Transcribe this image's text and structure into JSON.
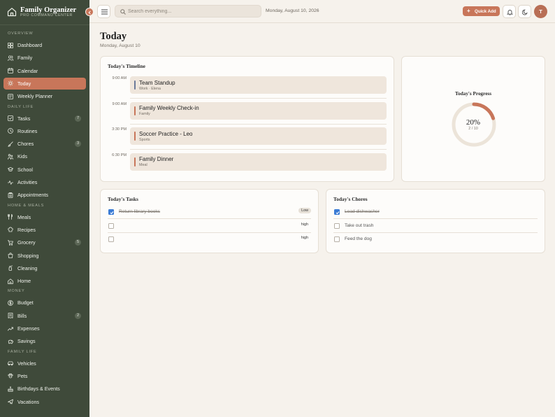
{
  "brand": {
    "title": "Family Organizer",
    "subtitle": "PRO COMMAND CENTER"
  },
  "sidebar": {
    "sections": [
      {
        "label": "OVERVIEW",
        "items": [
          {
            "label": "Dashboard",
            "icon": "grid-icon"
          },
          {
            "label": "Family",
            "icon": "users-icon"
          },
          {
            "label": "Calendar",
            "icon": "calendar-icon"
          },
          {
            "label": "Today",
            "icon": "sun-icon",
            "active": true
          },
          {
            "label": "Weekly Planner",
            "icon": "planner-icon"
          }
        ]
      },
      {
        "label": "DAILY LIFE",
        "items": [
          {
            "label": "Tasks",
            "icon": "check-square-icon",
            "badge": "7"
          },
          {
            "label": "Routines",
            "icon": "clock-icon"
          },
          {
            "label": "Chores",
            "icon": "brush-icon",
            "badge": "3"
          },
          {
            "label": "Kids",
            "icon": "kids-icon"
          },
          {
            "label": "School",
            "icon": "graduation-cap-icon"
          },
          {
            "label": "Activities",
            "icon": "activity-icon"
          },
          {
            "label": "Appointments",
            "icon": "clipboard-icon"
          }
        ]
      },
      {
        "label": "HOME & MEALS",
        "items": [
          {
            "label": "Meals",
            "icon": "utensils-icon"
          },
          {
            "label": "Recipes",
            "icon": "chef-hat-icon"
          },
          {
            "label": "Grocery",
            "icon": "cart-icon",
            "badge": "5"
          },
          {
            "label": "Shopping",
            "icon": "shopping-bag-icon"
          },
          {
            "label": "Cleaning",
            "icon": "spray-bottle-icon"
          },
          {
            "label": "Home",
            "icon": "home-icon"
          }
        ]
      },
      {
        "label": "MONEY",
        "items": [
          {
            "label": "Budget",
            "icon": "dollar-circle-icon"
          },
          {
            "label": "Bills",
            "icon": "receipt-icon",
            "badge": "2"
          },
          {
            "label": "Expenses",
            "icon": "trending-icon"
          },
          {
            "label": "Savings",
            "icon": "piggy-bank-icon"
          }
        ]
      },
      {
        "label": "FAMILY LIFE",
        "items": [
          {
            "label": "Vehicles",
            "icon": "car-icon"
          },
          {
            "label": "Pets",
            "icon": "paw-icon"
          },
          {
            "label": "Birthdays & Events",
            "icon": "cake-icon"
          },
          {
            "label": "Vacations",
            "icon": "plane-icon"
          }
        ]
      }
    ]
  },
  "topbar": {
    "search_placeholder": "Search everything...",
    "date": "Monday, August 10, 2026",
    "quick_add_label": "Quick Add",
    "avatar_initial": "T"
  },
  "page": {
    "title": "Today",
    "subtitle": "Monday, August 10"
  },
  "timeline": {
    "title": "Today's Timeline",
    "events": [
      {
        "time": "9:00 AM",
        "name": "Team Standup",
        "meta": "Work · Elena",
        "color": "#6c7a9a"
      },
      {
        "time": "9:00 AM",
        "name": "Family Weekly Check-in",
        "meta": "Family",
        "color": "#c8765a"
      },
      {
        "time": "3:30 PM",
        "name": "Soccer Practice - Leo",
        "meta": "Sports",
        "color": "#c8765a"
      },
      {
        "time": "6:30 PM",
        "name": "Family Dinner",
        "meta": "Meal",
        "color": "#c8765a"
      }
    ]
  },
  "progress": {
    "title": "Today's Progress",
    "percent_label": "20%",
    "count_label": "2 / 10",
    "fraction": 0.2
  },
  "tasks": {
    "title": "Today's Tasks",
    "items": [
      {
        "text": "Return library books",
        "priority": "Low",
        "done": true
      },
      {
        "text": "",
        "priority": "high",
        "done": false
      },
      {
        "text": "",
        "priority": "high",
        "done": false
      }
    ]
  },
  "chores": {
    "title": "Today's Chores",
    "items": [
      {
        "text": "Load dishwasher",
        "done": true
      },
      {
        "text": "Take out trash",
        "done": false
      },
      {
        "text": "Feed the dog",
        "done": false
      }
    ]
  },
  "colors": {
    "sidebar_bg": "#3f4a3a",
    "accent": "#c8765a",
    "page_bg": "#f6f2ec",
    "checkbox_checked": "#3a7bd5"
  }
}
